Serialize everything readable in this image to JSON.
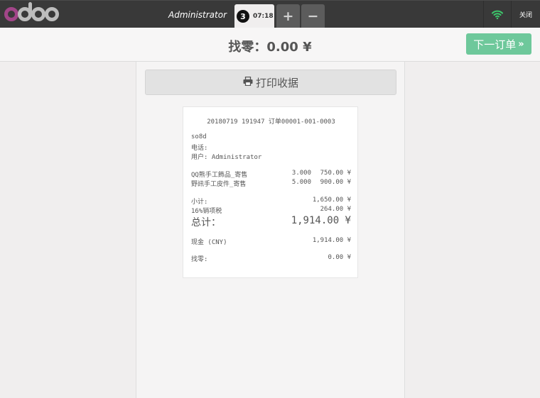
{
  "header": {
    "user": "Administrator",
    "order_seq": "3",
    "order_time": "07:18",
    "add_label": "+",
    "remove_label": "−",
    "close_label": "关闭"
  },
  "change_bar": {
    "title": "找零：0.00 ¥",
    "next_label": "下一订单",
    "next_chevron": "»"
  },
  "print_button": {
    "label": "打印收据"
  },
  "receipt": {
    "header_line": "20180719 191947 订单00001-001-0003",
    "company": "so8d",
    "phone_label": "电话:",
    "user_line": "用户: Administrator",
    "lines": [
      {
        "name": "QQ熊手工飾品_寄售",
        "qty": "3.000",
        "price": "750.00 ¥"
      },
      {
        "name": "野訊手工皮件_寄售",
        "qty": "5.000",
        "price": "900.00 ¥"
      }
    ],
    "subtotal_label": "小计:",
    "subtotal_value": "1,650.00 ¥",
    "tax_label": "16%销项税",
    "tax_value": "264.00 ¥",
    "total_label": "总计：",
    "total_value": "1,914.00 ¥",
    "payment_label": "现金 (CNY)",
    "payment_value": "1,914.00 ¥",
    "change_label": "找零:",
    "change_value": "0.00 ¥"
  },
  "colors": {
    "navbar": "#393939",
    "logo_accent": "#a24689",
    "next_button": "#6ec89b",
    "wifi": "#3cc86b"
  }
}
